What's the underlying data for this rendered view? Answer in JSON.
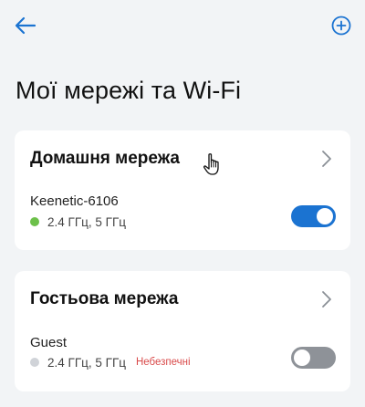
{
  "colors": {
    "accent": "#1b73d1",
    "background": "#f2f4f6",
    "card": "#ffffff",
    "status_online": "#6cc04a",
    "status_offline": "#d0d3d8",
    "toggle_on": "#1b73d1",
    "toggle_off": "#8e9298",
    "warning": "#d94a4a",
    "chevron": "#8a8f96"
  },
  "toolbar": {
    "back_icon": "arrow-left-icon",
    "add_icon": "plus-circle-icon"
  },
  "page": {
    "title": "Мої мережі та Wi-Fi"
  },
  "networks": [
    {
      "title": "Домашня мережа",
      "ssid": "Keenetic-6106",
      "bands": "2.4 ГГц, 5 ГГц",
      "status": "online",
      "warning": "",
      "enabled": true
    },
    {
      "title": "Гостьова мережа",
      "ssid": "Guest",
      "bands": "2.4 ГГц, 5 ГГц",
      "status": "offline",
      "warning": "Небезпечні",
      "enabled": false
    }
  ]
}
